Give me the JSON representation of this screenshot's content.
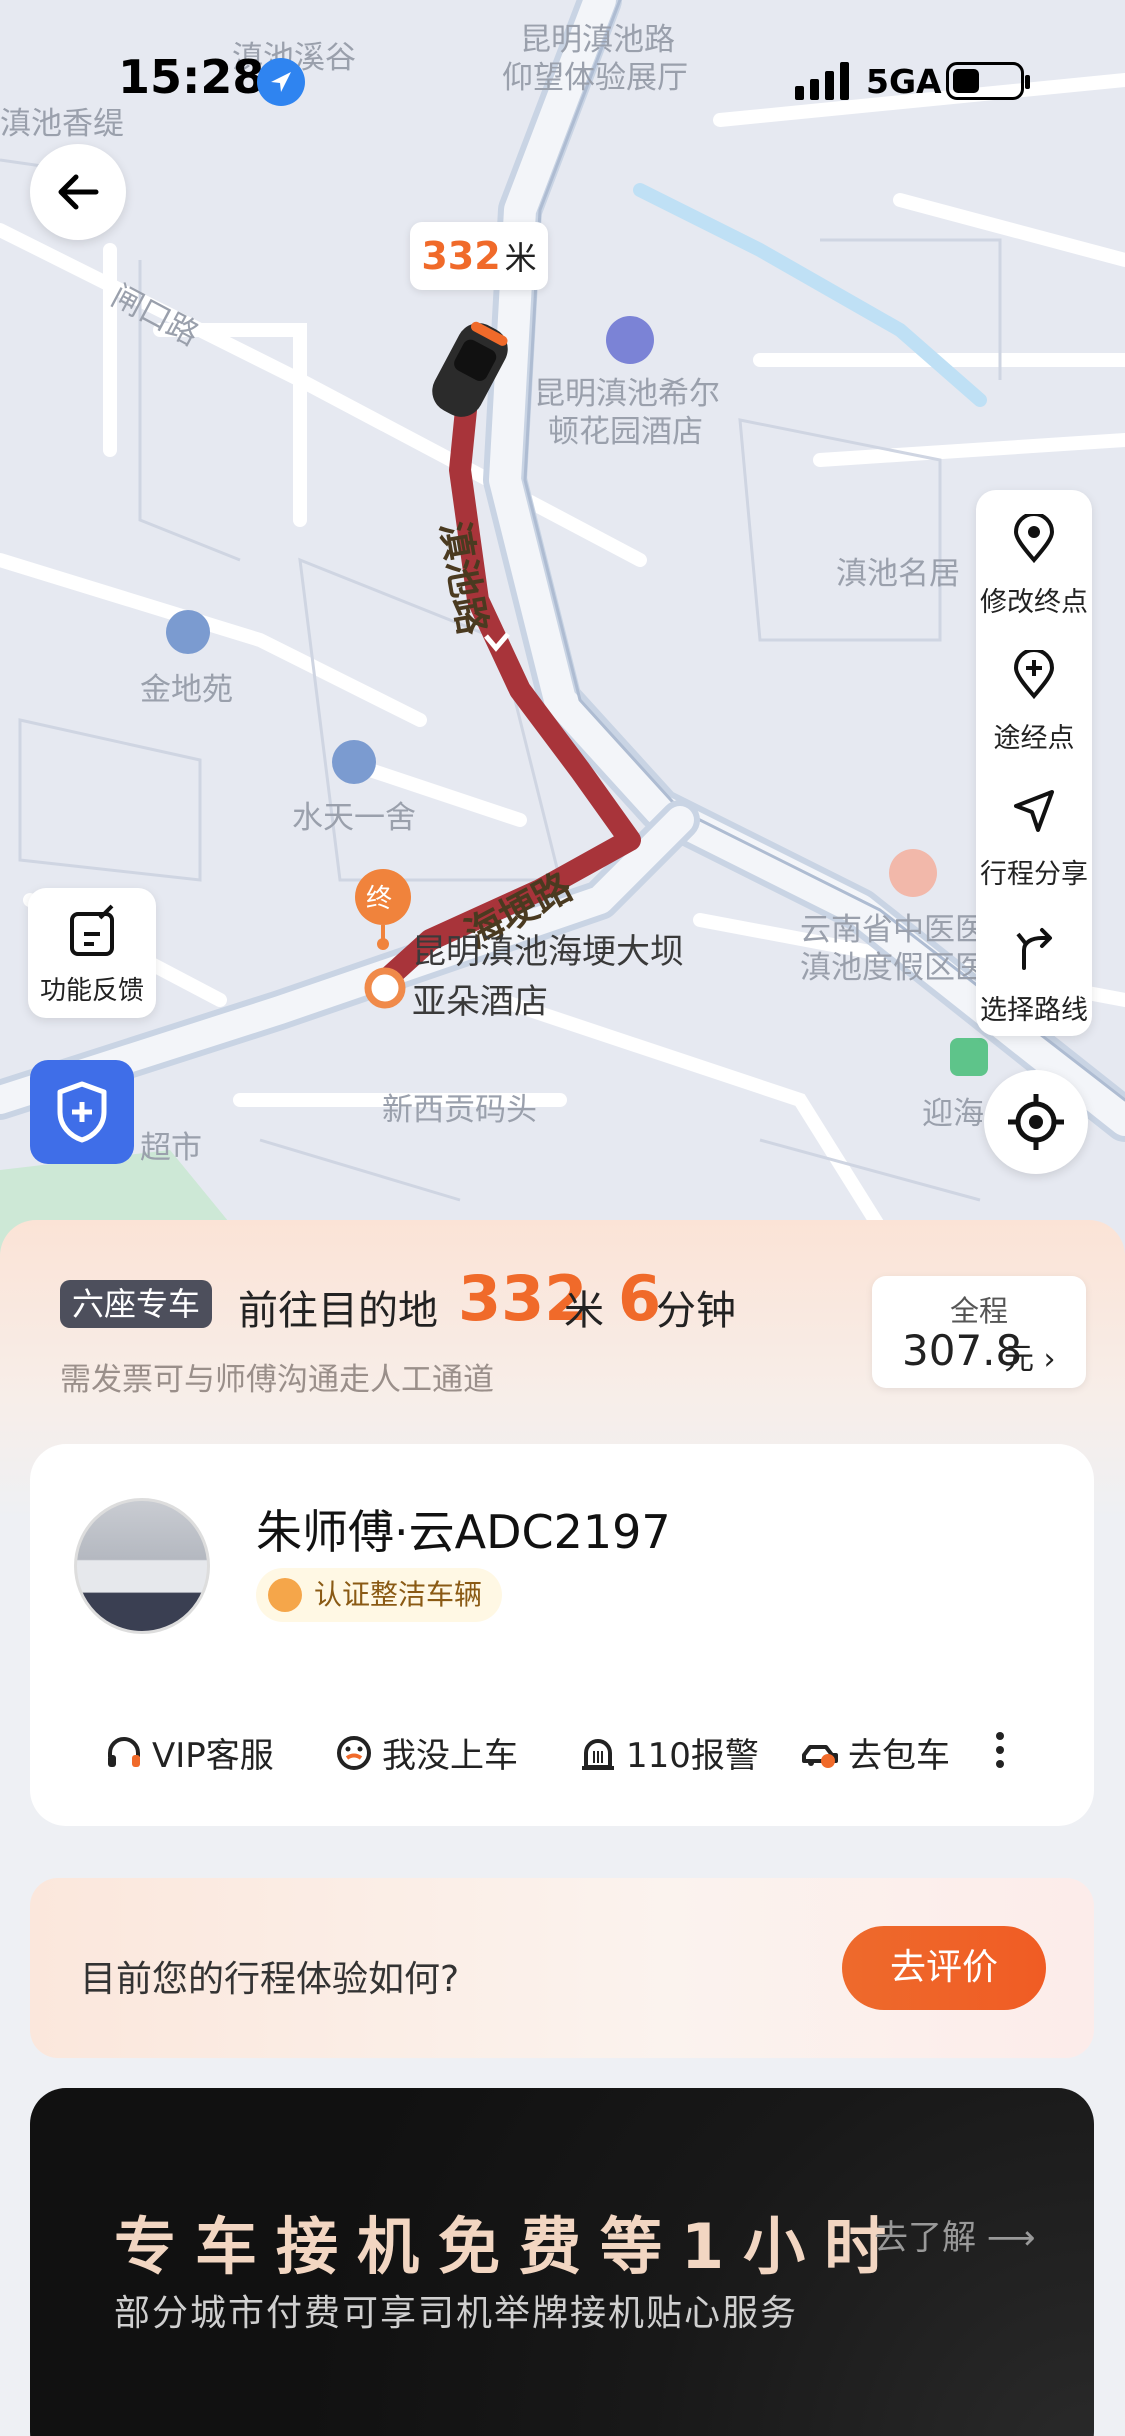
{
  "status_bar": {
    "time": "15:28",
    "network": "5GA"
  },
  "map": {
    "distance_bubble": {
      "value": "332",
      "unit": "米"
    },
    "labels": {
      "dianchi_xidi": "滇池溪谷",
      "dianchi_xiangti": "滇池香缇",
      "kunming_dianchi_road": "昆明滇池路",
      "yangwang_hall": "仰望体验展厅",
      "zhakou_road": "闸口路",
      "hilton_1": "昆明滇池希尔",
      "hilton_2": "顿花园酒店",
      "dianchi_road": "滇池路",
      "dianchi_mingju": "滇池名居",
      "jindiyuan": "金地苑",
      "shuitian": "水天一舍",
      "haigeng_road": "海埂路",
      "dest_1": "昆明滇池海埂大坝",
      "dest_2": "亚朵酒店",
      "dest_marker": "终",
      "xinxigong": "新西贡码头",
      "hospital_1": "云南省中医医院",
      "hospital_2": "滇池度假区医院",
      "supermarket": "超市",
      "yinghai": "迎海"
    },
    "actions": [
      {
        "label": "修改终点",
        "icon": "pin-icon"
      },
      {
        "label": "途经点",
        "icon": "add-waypoint-icon"
      },
      {
        "label": "行程分享",
        "icon": "share-plane-icon"
      },
      {
        "label": "选择路线",
        "icon": "route-icon"
      }
    ],
    "feedback_label": "功能反馈"
  },
  "trip": {
    "car_type": "六座专车",
    "dest_text": "前往目的地",
    "distance": "332",
    "distance_unit": "米",
    "minutes": "6",
    "minutes_unit": "分钟",
    "note": "需发票可与师傅沟通走人工通道",
    "fare": {
      "label": "全程",
      "amount": "307.8",
      "unit": "元 ›"
    }
  },
  "driver": {
    "name": "朱师傅·云ADC2197",
    "badge": "认证整洁车辆",
    "actions": [
      "VIP客服",
      "我没上车",
      "110报警",
      "去包车"
    ]
  },
  "rating": {
    "question": "目前您的行程体验如何?",
    "button": "去评价"
  },
  "promo": {
    "title": "专车接机免费等1小时",
    "link": "去了解 ⟶",
    "subtitle": "部分城市付费可享司机举牌接机贴心服务"
  },
  "colors": {
    "accent": "#f06a2a",
    "route": "#a8343a",
    "safety_blue": "#3f6ee8"
  }
}
